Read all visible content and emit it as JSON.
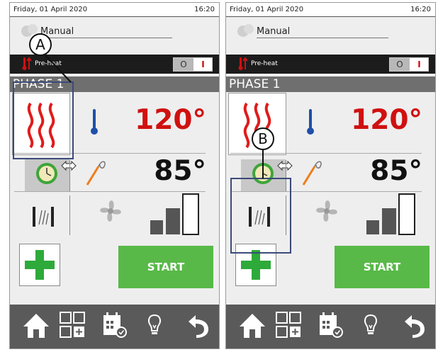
{
  "screens": [
    {
      "date": "Friday, 01 April 2020",
      "time": "16:20",
      "mode": "Manual",
      "preheat_label": "Pre-heat",
      "toggle_off": "O",
      "toggle_on": "I",
      "phase": "PHASE 1",
      "chamber_temp": "120°",
      "core_temp": "85°",
      "start_label": "START",
      "callout": "A"
    },
    {
      "date": "Friday, 01 April 2020",
      "time": "16:20",
      "mode": "Manual",
      "preheat_label": "Pre-heat",
      "toggle_off": "O",
      "toggle_on": "I",
      "phase": "PHASE 1",
      "chamber_temp": "120°",
      "core_temp": "85°",
      "start_label": "START",
      "callout": "B"
    }
  ],
  "fan_speed_level": "3 of 3",
  "icons": [
    "cloud-icon",
    "thermometer-icon",
    "heat-waves-icon",
    "clock-icon",
    "swap-arrows-icon",
    "core-probe-icon",
    "vent-icon",
    "fan-icon",
    "fan-speed-bars-icon",
    "plus-icon",
    "home-icon",
    "add-program-icon",
    "calendar-icon",
    "lightbulb-icon",
    "back-icon"
  ],
  "colors": {
    "start_green": "#58b948",
    "plus_green": "#2eaa3a",
    "temp_red": "#d01010",
    "nav_bg": "#5a5a5a",
    "phase_bg": "#6f6f6f",
    "callout_blue": "#3b4a7a"
  }
}
